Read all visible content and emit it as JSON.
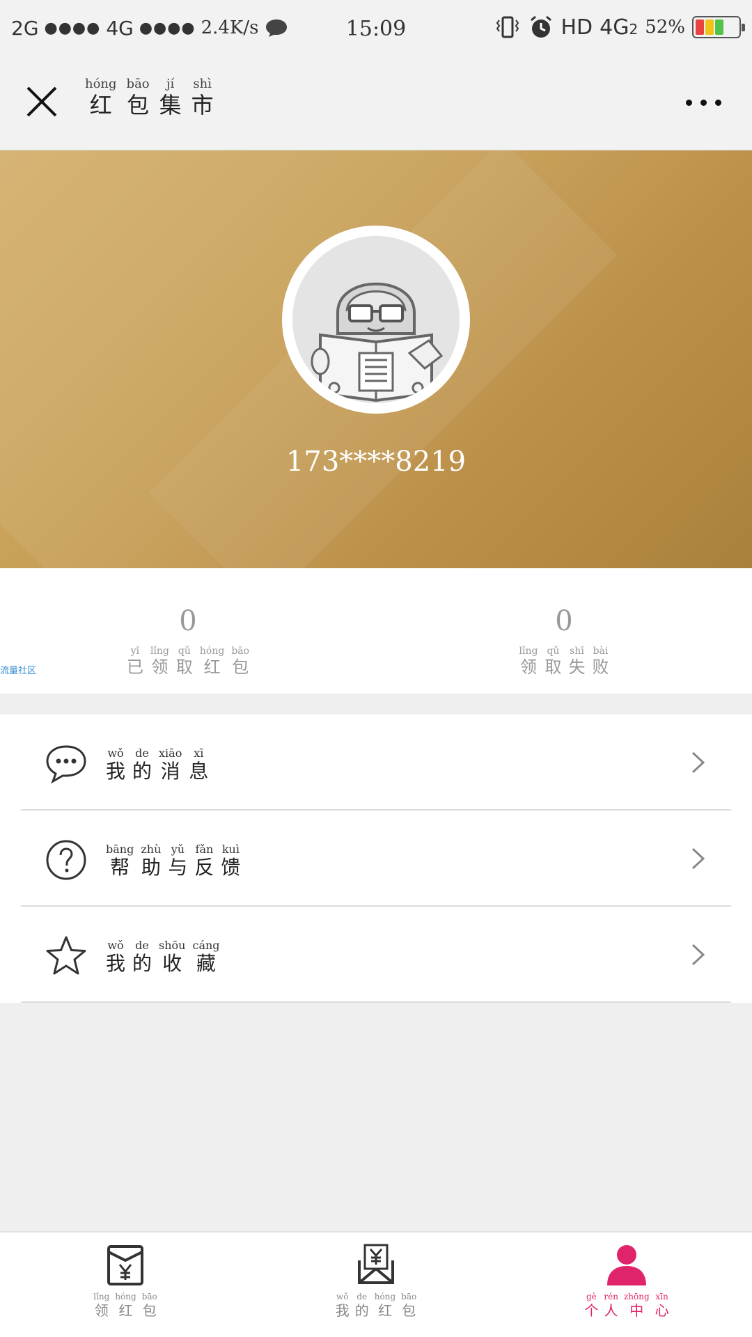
{
  "status_bar": {
    "network1": "2G",
    "dots1": "●●●●",
    "network2": "4G",
    "dots2": "●●●●",
    "speed": "2.4K/s",
    "time": "15:09",
    "hd": "HD",
    "network3": "4G",
    "sim": "2",
    "battery": "52%"
  },
  "title_bar": {
    "title": [
      {
        "py": "hóng",
        "c": "红"
      },
      {
        "py": "bāo",
        "c": "包"
      },
      {
        "py": "jí",
        "c": "集"
      },
      {
        "py": "shì",
        "c": "市"
      }
    ]
  },
  "profile": {
    "phone": "173****8219"
  },
  "stats": [
    {
      "value": "0",
      "label": [
        {
          "py": "yǐ",
          "c": "已"
        },
        {
          "py": "lǐng",
          "c": "领"
        },
        {
          "py": "qǔ",
          "c": "取"
        },
        {
          "py": "hóng",
          "c": "红"
        },
        {
          "py": "bāo",
          "c": "包"
        }
      ]
    },
    {
      "value": "0",
      "label": [
        {
          "py": "lǐng",
          "c": "领"
        },
        {
          "py": "qǔ",
          "c": "取"
        },
        {
          "py": "shī",
          "c": "失"
        },
        {
          "py": "bài",
          "c": "败"
        }
      ]
    }
  ],
  "side_tag": "流量社区",
  "menu": [
    {
      "icon": "chat-bubble-icon",
      "label": [
        {
          "py": "wǒ",
          "c": "我"
        },
        {
          "py": "de",
          "c": "的"
        },
        {
          "py": "xiāo",
          "c": "消"
        },
        {
          "py": "xī",
          "c": "息"
        }
      ]
    },
    {
      "icon": "help-question-icon",
      "label": [
        {
          "py": "bāng",
          "c": "帮"
        },
        {
          "py": "zhù",
          "c": "助"
        },
        {
          "py": "yǔ",
          "c": "与"
        },
        {
          "py": "fǎn",
          "c": "反"
        },
        {
          "py": "kuì",
          "c": "馈"
        }
      ]
    },
    {
      "icon": "star-icon",
      "label": [
        {
          "py": "wǒ",
          "c": "我"
        },
        {
          "py": "de",
          "c": "的"
        },
        {
          "py": "shōu",
          "c": "收"
        },
        {
          "py": "cáng",
          "c": "藏"
        }
      ]
    }
  ],
  "bottom_nav": [
    {
      "icon": "red-envelope-icon",
      "active": false,
      "label": [
        {
          "py": "lǐng",
          "c": "领"
        },
        {
          "py": "hóng",
          "c": "红"
        },
        {
          "py": "bāo",
          "c": "包"
        }
      ]
    },
    {
      "icon": "open-envelope-icon",
      "active": false,
      "label": [
        {
          "py": "wǒ",
          "c": "我"
        },
        {
          "py": "de",
          "c": "的"
        },
        {
          "py": "hóng",
          "c": "红"
        },
        {
          "py": "bāo",
          "c": "包"
        }
      ]
    },
    {
      "icon": "person-icon",
      "active": true,
      "label": [
        {
          "py": "gè",
          "c": "个"
        },
        {
          "py": "rén",
          "c": "人"
        },
        {
          "py": "zhōng",
          "c": "中"
        },
        {
          "py": "xīn",
          "c": "心"
        }
      ]
    }
  ],
  "colors": {
    "accent": "#e0246b",
    "hero_gold": "#c29a52",
    "battery_red": "#e8433f",
    "battery_yellow": "#f2c21b",
    "battery_green": "#53c24b"
  }
}
